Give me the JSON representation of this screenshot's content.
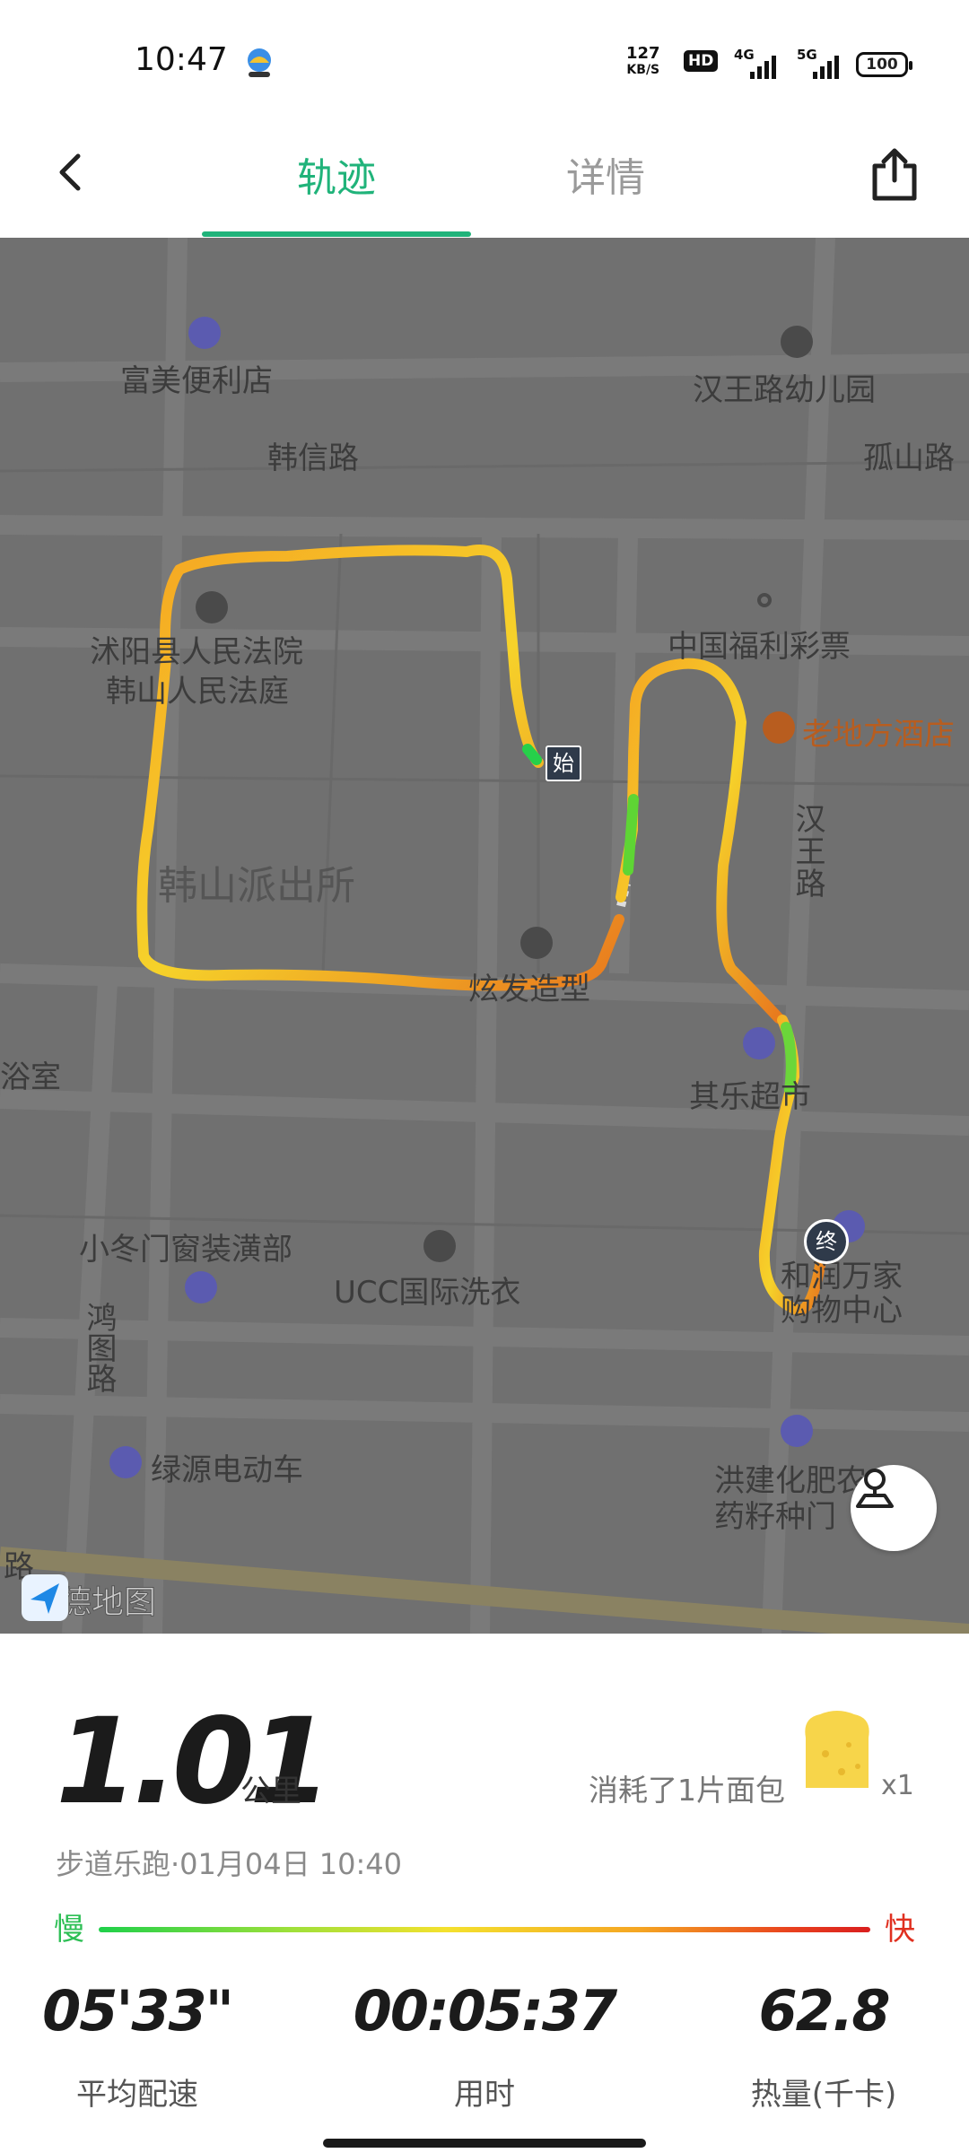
{
  "status_bar": {
    "time": "10:47",
    "net_speed_value": "127",
    "net_speed_unit": "KB/S",
    "hd": "HD",
    "signal_1": "4G",
    "signal_2": "5G",
    "battery": "100"
  },
  "nav": {
    "tab_track": "轨迹",
    "tab_detail": "详情",
    "active_tab": "轨迹",
    "accent_color": "#20b37a"
  },
  "map": {
    "labels": {
      "fumei": "富美便利店",
      "hanwang_kindergarten": "汉王路幼儿园",
      "hanxin_road": "韩信路",
      "gushan_road": "孤山路",
      "court_1": "沭阳县人民法院",
      "court_2": "韩山人民法庭",
      "lottery": "中国福利彩票",
      "hotel": "老地方酒店",
      "police": "韩山派出所",
      "hanwang_road": "汉王路",
      "salon": "炫发造型",
      "bath": "浴室",
      "qile": "其乐超市",
      "xiaodongmen": "小冬门窗装潢部",
      "ucc": "UCC国际洗衣",
      "hetu_road": "鸿图路",
      "herun_1": "和润万家",
      "herun_2": "购物中心",
      "lvyuan": "绿源电动车",
      "hongjian_1": "洪建化肥农",
      "hongjian_2": "药籽种门",
      "road_fragment": "路",
      "start_marker": "始",
      "end_marker": "终",
      "logo_text": "高德地图"
    }
  },
  "summary": {
    "distance": "1.01",
    "distance_unit": "公里",
    "calorie_equivalent": "消耗了1片面包",
    "bread_count": "x1",
    "run_info": "步道乐跑·01月04日 10:40",
    "slow_label": "慢",
    "fast_label": "快"
  },
  "stats": {
    "avg_pace_value": "05'33\"",
    "avg_pace_label": "平均配速",
    "duration_value": "00:05:37",
    "duration_label": "用时",
    "calories_value": "62.8",
    "calories_label": "热量(千卡)"
  }
}
